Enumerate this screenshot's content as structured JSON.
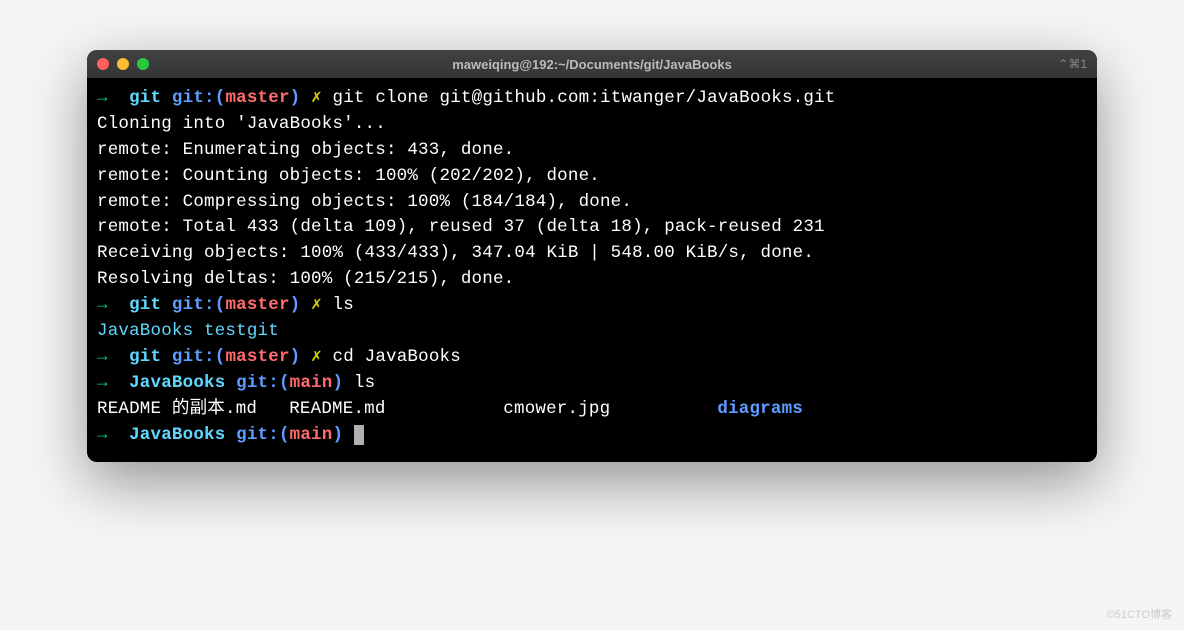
{
  "window": {
    "title": "maweiqing@192:~/Documents/git/JavaBooks",
    "shortcut": "⌃⌘1"
  },
  "prompt1": {
    "arrow": "→",
    "cwd": "git",
    "git_prefix": "git:(",
    "branch": "master",
    "git_suffix": ")",
    "lightning": "✗",
    "cmd": "git clone git@github.com:itwanger/JavaBooks.git"
  },
  "output": {
    "l1": "Cloning into 'JavaBooks'...",
    "l2": "remote: Enumerating objects: 433, done.",
    "l3": "remote: Counting objects: 100% (202/202), done.",
    "l4": "remote: Compressing objects: 100% (184/184), done.",
    "l5": "remote: Total 433 (delta 109), reused 37 (delta 18), pack-reused 231",
    "l6": "Receiving objects: 100% (433/433), 347.04 KiB | 548.00 KiB/s, done.",
    "l7": "Resolving deltas: 100% (215/215), done."
  },
  "prompt2": {
    "arrow": "→",
    "cwd": "git",
    "git_prefix": "git:(",
    "branch": "master",
    "git_suffix": ")",
    "lightning": "✗",
    "cmd": "ls"
  },
  "ls1": {
    "item1": "JavaBooks",
    "item2": "testgit"
  },
  "prompt3": {
    "arrow": "→",
    "cwd": "git",
    "git_prefix": "git:(",
    "branch": "master",
    "git_suffix": ")",
    "lightning": "✗",
    "cmd": "cd JavaBooks"
  },
  "prompt4": {
    "arrow": "→",
    "cwd": "JavaBooks",
    "git_prefix": "git:(",
    "branch": "main",
    "git_suffix": ")",
    "cmd": "ls"
  },
  "ls2": {
    "item1": "README 的副本.md",
    "item2": "README.md",
    "item3": "cmower.jpg",
    "item4": "diagrams"
  },
  "prompt5": {
    "arrow": "→",
    "cwd": "JavaBooks",
    "git_prefix": "git:(",
    "branch": "main",
    "git_suffix": ")"
  },
  "watermark": "©51CTO博客"
}
